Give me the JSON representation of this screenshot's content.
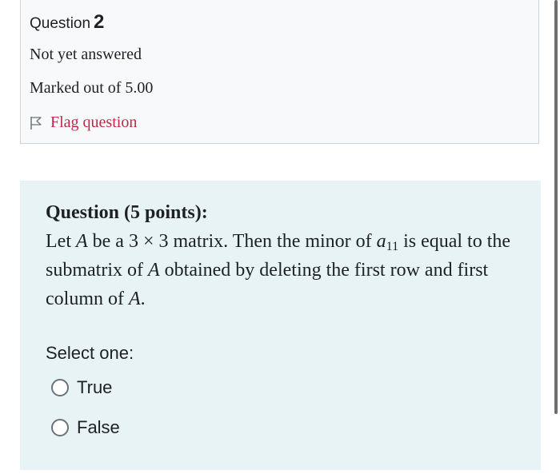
{
  "question_info": {
    "label": "Question",
    "number": "2",
    "state": "Not yet answered",
    "grade": "Marked out of 5.00",
    "flag_label": "Flag question"
  },
  "question": {
    "heading": "Question (5 points):",
    "text_1": "Let ",
    "var_A": "A",
    "text_2": " be a 3 × 3 matrix. Then the minor of ",
    "var_a": "a",
    "sub_11": "11",
    "text_3": " is equal to the submatrix of ",
    "var_A2": "A",
    "text_4": " obtained by deleting the first row and first column of ",
    "var_A3": "A",
    "text_5": "."
  },
  "answer": {
    "prompt": "Select one:",
    "options": [
      {
        "label": "True",
        "selected": false
      },
      {
        "label": "False",
        "selected": false
      }
    ]
  },
  "colors": {
    "info_background": "#f8f9fa",
    "content_background": "#e7f3f5",
    "flag_color": "#c0284a"
  }
}
